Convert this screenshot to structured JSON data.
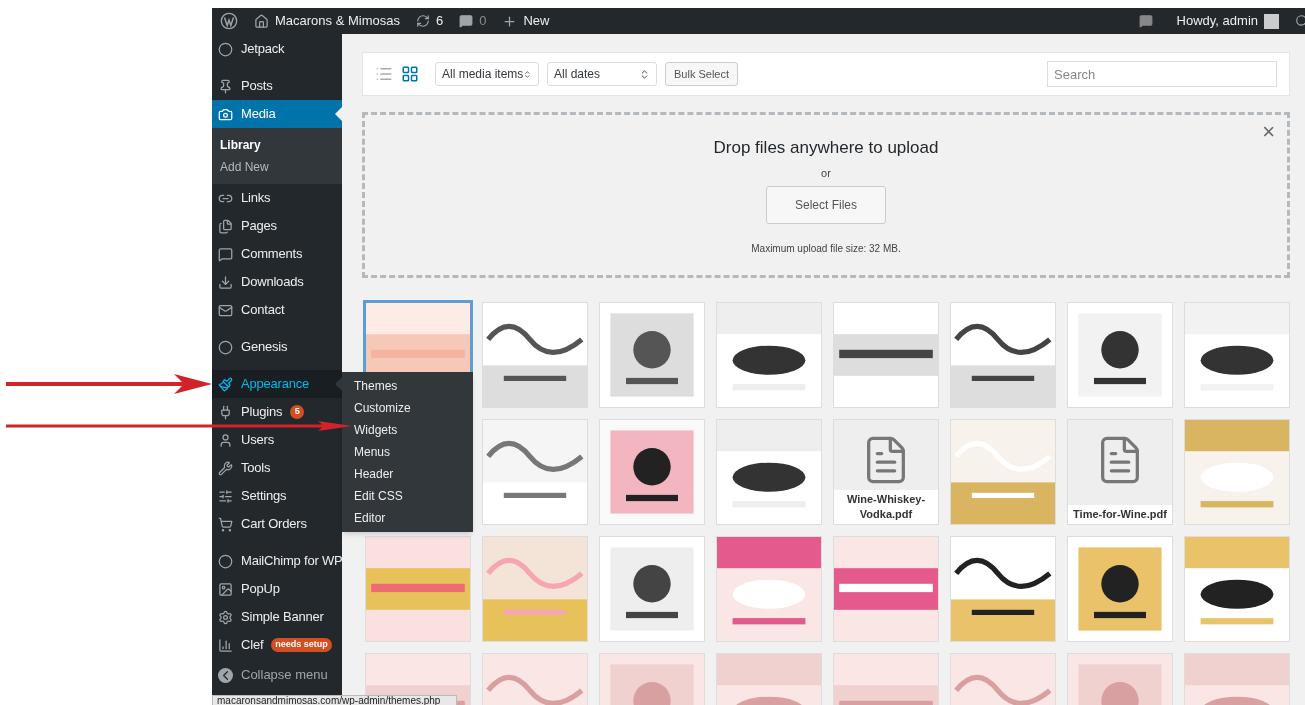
{
  "admin_bar": {
    "site_name": "Macarons & Mimosas",
    "updates": "6",
    "comments": "0",
    "new": "New",
    "greeting": "Howdy, admin"
  },
  "sidebar": {
    "groups": [
      [
        {
          "label": "Jetpack",
          "selected": false,
          "hovered": false
        }
      ],
      [
        {
          "label": "Posts",
          "selected": false,
          "hovered": false
        },
        {
          "label": "Media",
          "selected": true,
          "hovered": false,
          "children": [
            {
              "label": "Library",
              "selected": true
            },
            {
              "label": "Add New",
              "selected": false
            }
          ]
        },
        {
          "label": "Links",
          "selected": false,
          "hovered": false
        },
        {
          "label": "Pages",
          "selected": false,
          "hovered": false
        },
        {
          "label": "Comments",
          "selected": false,
          "hovered": false
        },
        {
          "label": "Downloads",
          "selected": false,
          "hovered": false
        },
        {
          "label": "Contact",
          "selected": false,
          "hovered": false
        }
      ],
      [
        {
          "label": "Genesis",
          "selected": false,
          "hovered": false
        }
      ],
      [
        {
          "label": "Appearance",
          "selected": false,
          "hovered": true
        },
        {
          "label": "Plugins",
          "selected": false,
          "hovered": false,
          "badge": "5"
        },
        {
          "label": "Users",
          "selected": false,
          "hovered": false
        },
        {
          "label": "Tools",
          "selected": false,
          "hovered": false
        },
        {
          "label": "Settings",
          "selected": false,
          "hovered": false
        },
        {
          "label": "Cart Orders",
          "selected": false,
          "hovered": false
        }
      ],
      [
        {
          "label": "MailChimp for WP",
          "selected": false,
          "hovered": false
        },
        {
          "label": "PopUp",
          "selected": false,
          "hovered": false
        },
        {
          "label": "Simple Banner",
          "selected": false,
          "hovered": false
        },
        {
          "label": "Clef",
          "selected": false,
          "hovered": false,
          "badge": "needs setup"
        }
      ]
    ],
    "collapse": "Collapse menu"
  },
  "flyout": {
    "items": [
      "Themes",
      "Customize",
      "Widgets",
      "Menus",
      "Header",
      "Edit CSS",
      "Editor"
    ]
  },
  "toolbar": {
    "view_modes": [
      {
        "selected": false
      },
      {
        "selected": true
      }
    ],
    "filters": [
      "All media items",
      "All dates"
    ],
    "bulk_select": "Bulk Select",
    "search": {
      "placeholder": "Search"
    }
  },
  "upload": {
    "heading": "Drop files anywhere to upload",
    "or": "or",
    "button": "Select Files",
    "max_size": "Maximum upload file size: 32 MB.",
    "close": "×"
  },
  "media_grid": [
    [
      {
        "kind": "picture",
        "selected": true
      },
      {
        "kind": "picture",
        "selected": false
      },
      {
        "kind": "picture",
        "selected": false
      },
      {
        "kind": "picture",
        "selected": false
      },
      {
        "kind": "picture",
        "selected": false
      },
      {
        "kind": "picture",
        "selected": false
      },
      {
        "kind": "picture",
        "selected": false
      },
      {
        "kind": "picture",
        "selected": false
      }
    ],
    [
      {
        "kind": "picture",
        "selected": false
      },
      {
        "kind": "picture",
        "selected": false
      },
      {
        "kind": "picture",
        "selected": false
      },
      {
        "kind": "file",
        "filename": "Wine-Whiskey-Vodka.pdf",
        "selected": false
      },
      {
        "kind": "picture",
        "selected": false
      },
      {
        "kind": "file",
        "filename": "Time-for-Wine.pdf",
        "selected": false
      },
      {
        "kind": "picture",
        "selected": false
      }
    ],
    [
      {
        "kind": "picture",
        "selected": false
      },
      {
        "kind": "picture",
        "selected": false
      },
      {
        "kind": "picture",
        "selected": false
      },
      {
        "kind": "picture",
        "selected": false
      },
      {
        "kind": "picture",
        "selected": false
      },
      {
        "kind": "picture",
        "selected": false
      },
      {
        "kind": "picture",
        "selected": false
      },
      {
        "kind": "picture",
        "selected": false
      }
    ],
    [
      {
        "kind": "picture",
        "selected": false
      },
      {
        "kind": "picture",
        "selected": false
      },
      {
        "kind": "picture",
        "selected": false
      },
      {
        "kind": "picture",
        "selected": false
      },
      {
        "kind": "picture",
        "selected": false
      },
      {
        "kind": "picture",
        "selected": false
      },
      {
        "kind": "picture",
        "selected": false
      },
      {
        "kind": "picture",
        "selected": false
      }
    ]
  ],
  "status_url": "macaronsandmimosas.com/wp-admin/themes.php"
}
